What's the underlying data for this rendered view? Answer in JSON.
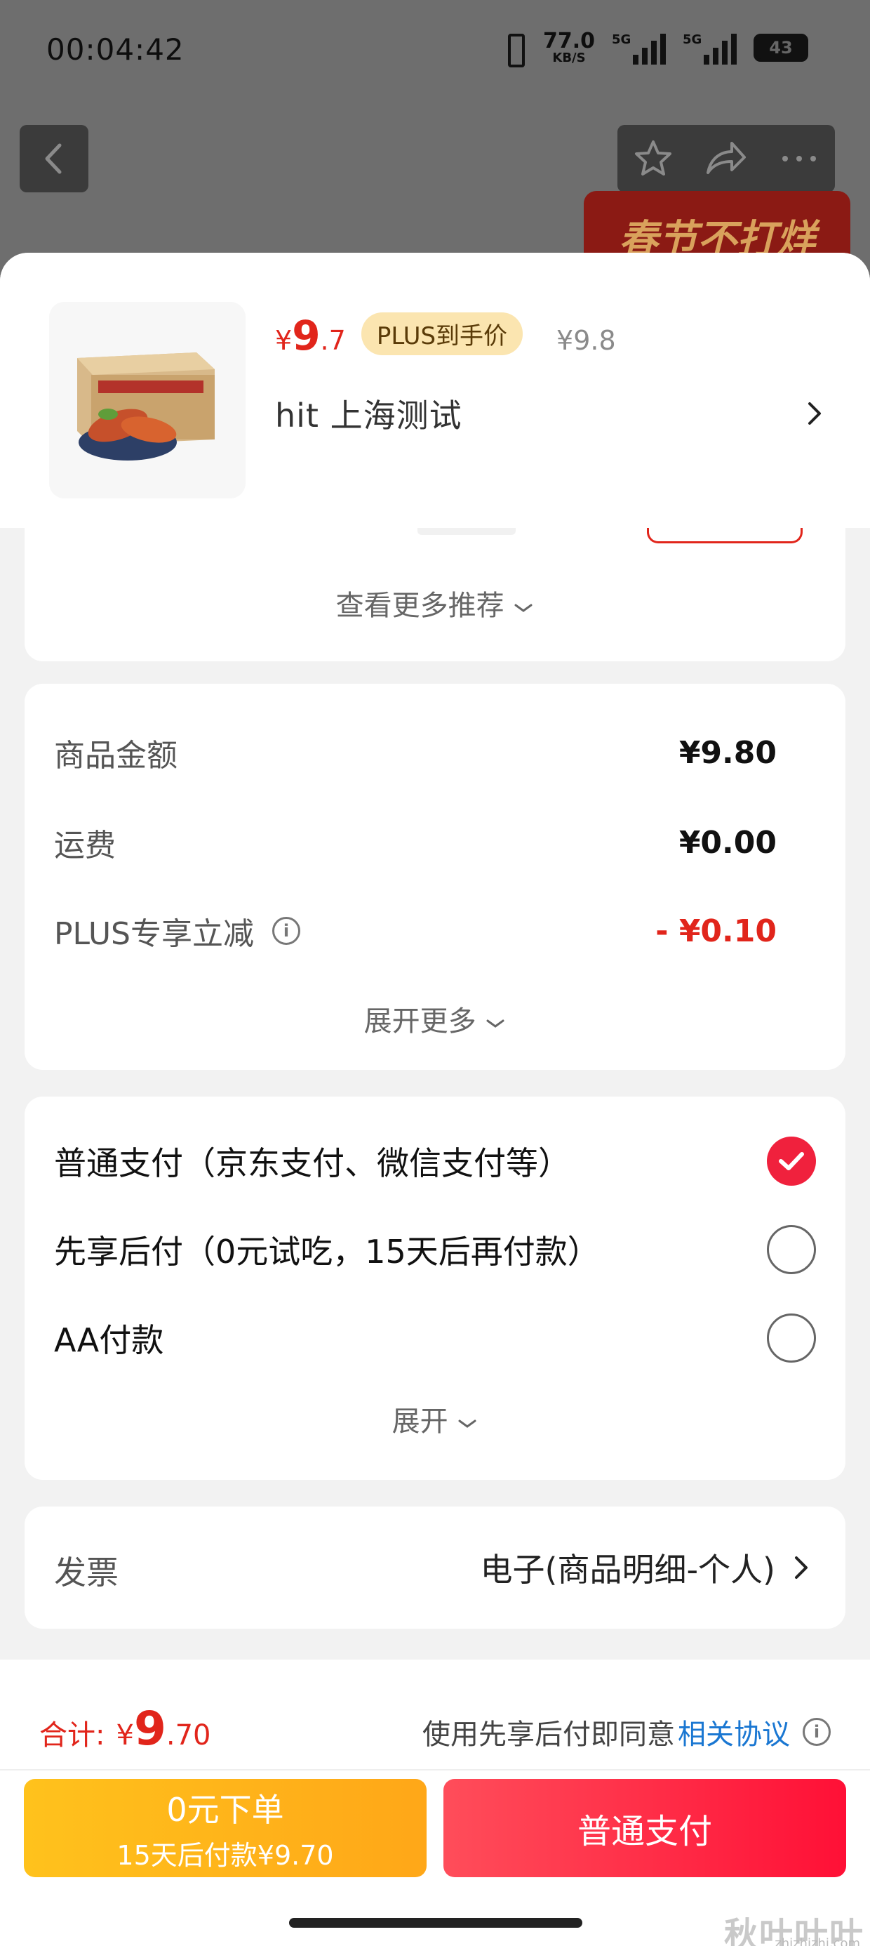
{
  "status_bar": {
    "time": "00:04:42",
    "net_speed_value": "77.0",
    "net_speed_unit": "KB/S",
    "signal1_label": "5G",
    "signal2_label": "5G",
    "battery": "43"
  },
  "promo_banner": {
    "text": "春节不打烊"
  },
  "sheet": {
    "price": {
      "currency": "¥",
      "integer": "9",
      "decimal": ".7"
    },
    "plus_tag": "PLUS到手价",
    "original_price": "¥9.8",
    "address": "hit  上海测试"
  },
  "recommend": {
    "more_label": "查看更多推荐"
  },
  "amounts": {
    "rows": [
      {
        "label": "商品金额",
        "value": "¥9.80"
      },
      {
        "label": "运费",
        "value": "¥0.00"
      },
      {
        "label": "PLUS专享立减",
        "value": "- ¥0.10"
      }
    ],
    "expand_label": "展开更多"
  },
  "payment": {
    "options": [
      {
        "label": "普通支付（京东支付、微信支付等）",
        "checked": true
      },
      {
        "label": "先享后付（0元试吃，15天后再付款）",
        "checked": false
      },
      {
        "label": "AA付款",
        "checked": false
      }
    ],
    "expand_label": "展开"
  },
  "invoice": {
    "label": "发票",
    "value": "电子(商品明细-个人)"
  },
  "bottom_bar": {
    "total_label": "合计:",
    "total_currency": "¥",
    "total_integer": "9",
    "total_decimal": ".70",
    "agree_prefix": "使用先享后付即同意",
    "agree_link": "相关协议",
    "bnpl_line1": "0元下单",
    "bnpl_line2": "15天后付款¥9.70",
    "pay_label": "普通支付"
  },
  "watermark": {
    "main": "秋叶叶叶",
    "sub": "zhizhizhi.com"
  },
  "colors": {
    "accent_red": "#e1251b",
    "pay_red": "#ff1036",
    "bnpl_yellow": "#ffb21a",
    "link_blue": "#1a77d2"
  }
}
